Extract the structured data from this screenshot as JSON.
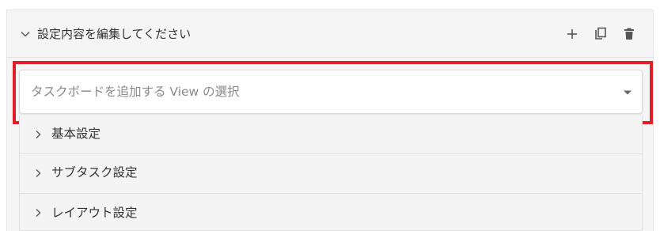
{
  "header": {
    "title": "設定内容を編集してください",
    "icons": [
      "chevron-down-icon",
      "plus-icon",
      "copy-icon",
      "trash-icon"
    ]
  },
  "view_select": {
    "placeholder": "タスクボードを追加する View の選択",
    "highlight_color": "#e01f26"
  },
  "sections": [
    {
      "label": "基本設定"
    },
    {
      "label": "サブタスク設定"
    },
    {
      "label": "レイアウト設定"
    }
  ]
}
